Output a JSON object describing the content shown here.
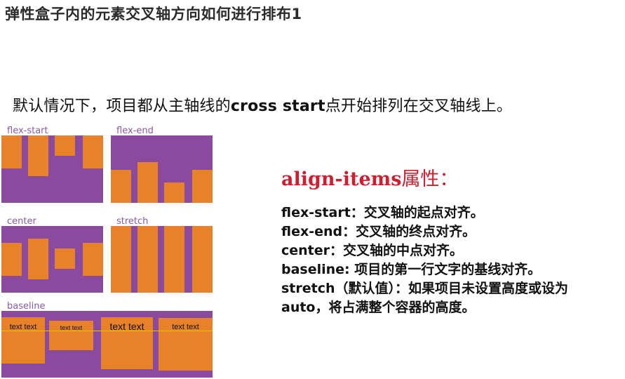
{
  "title": "弹性盒子内的元素交叉轴方向如何进行排布1",
  "intro": {
    "before": "默认情况下，项目都从主轴线的",
    "keyword": "cross start",
    "after": "点开始排列在交叉轴线上。"
  },
  "panels": {
    "flex_start": "flex-start",
    "flex_end": "flex-end",
    "center": "center",
    "stretch": "stretch",
    "baseline": "baseline"
  },
  "baseline_items": [
    "text text",
    "text text",
    "text text",
    "text text"
  ],
  "colors": {
    "container": "#8a4a9e",
    "item": "#e8822a",
    "label": "#8a59a8",
    "heading": "#cc2030",
    "baseline_line": "#f2c200"
  },
  "right": {
    "heading": "align-items",
    "heading_suffix": "属性：",
    "lines": [
      "flex-start：交叉轴的起点对齐。",
      "flex-end：交叉轴的终点对齐。",
      "center：交叉轴的中点对齐。",
      "baseline: 项目的第一行文字的基线对齐。",
      "stretch（默认值）：如果项目未设置高度或设为",
      "auto，将占满整个容器的高度。"
    ]
  }
}
